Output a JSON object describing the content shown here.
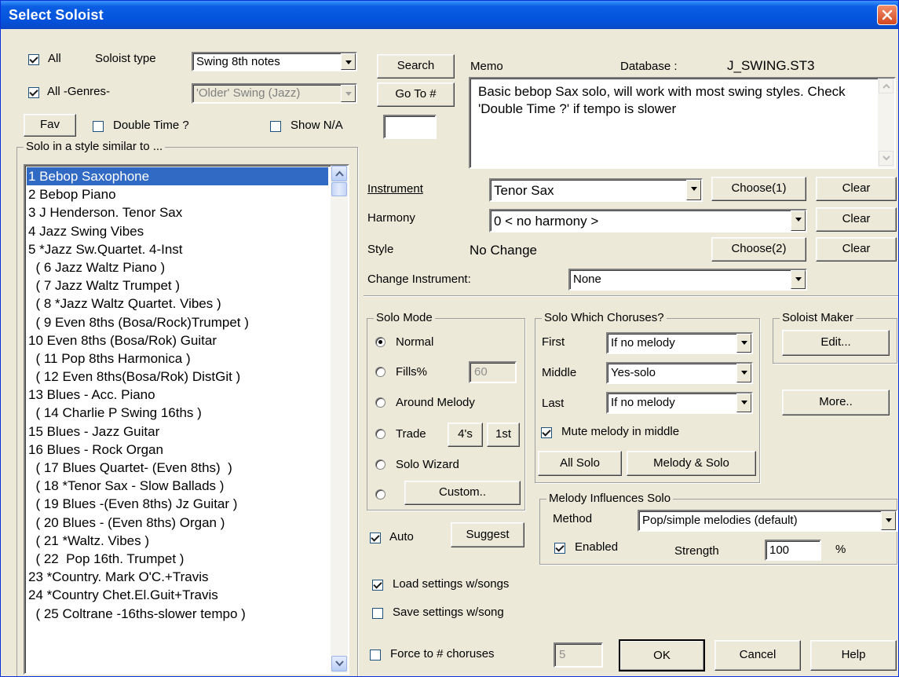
{
  "window": {
    "title": "Select Soloist"
  },
  "filters": {
    "all_label": "All",
    "soloist_type_label": "Soloist type",
    "soloist_type_value": "Swing 8th notes",
    "all_genres_label": "All -Genres-",
    "genre_value": "'Older' Swing (Jazz)",
    "fav_label": "Fav",
    "double_time_label": "Double Time ?",
    "show_na_label": "Show N/A"
  },
  "solo_list": {
    "group_label": "Solo in a style similar to ...",
    "selected_index": 0,
    "items": [
      "1 Bebop Saxophone",
      "2 Bebop Piano",
      "3 J Henderson. Tenor Sax",
      "4 Jazz Swing Vibes",
      "5 *Jazz Sw.Quartet. 4-Inst",
      "  ( 6 Jazz Waltz Piano )",
      "  ( 7 Jazz Waltz Trumpet )",
      "  ( 8 *Jazz Waltz Quartet. Vibes )",
      "  ( 9 Even 8ths (Bosa/Rock)Trumpet )",
      "10 Even 8ths (Bosa/Rok) Guitar",
      "  ( 11 Pop 8ths Harmonica )",
      "  ( 12 Even 8ths(Bosa/Rok) DistGit )",
      "13 Blues - Acc. Piano",
      "  ( 14 Charlie P Swing 16ths )",
      "15 Blues - Jazz Guitar",
      "16 Blues - Rock Organ",
      "  ( 17 Blues Quartet- (Even 8ths)  )",
      "  ( 18 *Tenor Sax - Slow Ballads )",
      "  ( 19 Blues -(Even 8ths) Jz Guitar )",
      "  ( 20 Blues - (Even 8ths) Organ )",
      "  ( 21 *Waltz. Vibes )",
      "  ( 22  Pop 16th. Trumpet )",
      "23 *Country. Mark O'C.+Travis",
      "24 *Country Chet.El.Guit+Travis",
      "  ( 25 Coltrane -16ths-slower tempo )"
    ]
  },
  "search": {
    "search_label": "Search",
    "goto_label": "Go To #",
    "goto_value": ""
  },
  "memo": {
    "label": "Memo",
    "database_label": "Database :",
    "database_value": "J_SWING.ST3",
    "text": "Basic bebop Sax solo, will work with most swing styles. Check 'Double Time ?' if tempo is slower"
  },
  "instrument": {
    "label": "Instrument",
    "value": "Tenor Sax",
    "choose_label": "Choose(1)",
    "clear_label": "Clear"
  },
  "harmony": {
    "label": "Harmony",
    "value": "0 < no harmony >",
    "clear_label": "Clear"
  },
  "style": {
    "label": "Style",
    "value": "No Change",
    "choose_label": "Choose(2)",
    "clear_label": "Clear"
  },
  "change_instrument": {
    "label": "Change Instrument:",
    "value": "None"
  },
  "solo_mode": {
    "group_label": "Solo Mode",
    "normal_label": "Normal",
    "fills_label": "Fills%",
    "fills_value": "60",
    "around_melody_label": "Around Melody",
    "trade_label": "Trade",
    "trade_4s_label": "4's",
    "trade_1st_label": "1st",
    "solo_wizard_label": "Solo Wizard",
    "custom_label": "Custom..",
    "selected": "normal"
  },
  "choruses": {
    "group_label": "Solo Which Choruses?",
    "first_label": "First",
    "first_value": "If no melody",
    "middle_label": "Middle",
    "middle_value": "Yes-solo",
    "last_label": "Last",
    "last_value": "If no melody",
    "mute_label": "Mute melody in middle",
    "all_solo_label": "All Solo",
    "melody_solo_label": "Melody & Solo"
  },
  "soloist_maker": {
    "group_label": "Soloist Maker",
    "edit_label": "Edit...",
    "more_label": "More.."
  },
  "auto": {
    "label": "Auto",
    "suggest_label": "Suggest"
  },
  "melody_influence": {
    "group_label": "Melody Influences Solo",
    "method_label": "Method",
    "method_value": "Pop/simple melodies (default)",
    "enabled_label": "Enabled",
    "strength_label": "Strength",
    "strength_value": "100",
    "percent_label": "%"
  },
  "settings": {
    "load_label": "Load settings w/songs",
    "save_label": "Save settings w/song"
  },
  "footer": {
    "force_label": "Force to # choruses",
    "force_value": "5",
    "ok_label": "OK",
    "cancel_label": "Cancel",
    "help_label": "Help"
  },
  "colors": {
    "title_bar": "#0a5fe3",
    "dialog_bg": "#ece9d8",
    "selection": "#316ac5"
  }
}
